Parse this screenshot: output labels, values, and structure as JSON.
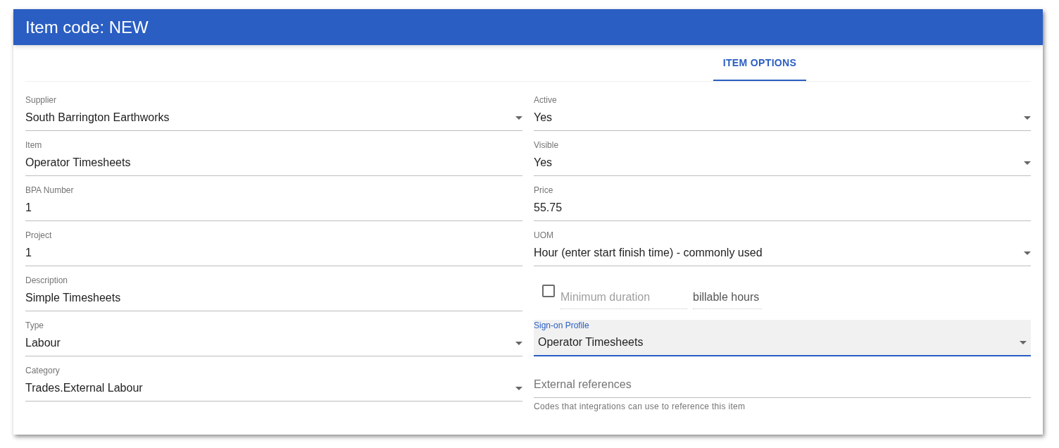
{
  "header": {
    "title": "Item code: NEW"
  },
  "tabs": [
    {
      "label": "ITEM OPTIONS",
      "selected": true
    }
  ],
  "left_fields": [
    {
      "kind": "select",
      "label": "Supplier",
      "value": "South Barrington Earthworks",
      "focused": false
    },
    {
      "kind": "text",
      "label": "Item",
      "value": "Operator Timesheets",
      "focused": false
    },
    {
      "kind": "text",
      "label": "BPA Number",
      "value": "1",
      "focused": false
    },
    {
      "kind": "text",
      "label": "Project",
      "value": "1",
      "focused": false
    },
    {
      "kind": "text",
      "label": "Description",
      "value": "Simple Timesheets",
      "focused": false
    },
    {
      "kind": "select",
      "label": "Type",
      "value": "Labour",
      "focused": false
    },
    {
      "kind": "select",
      "label": "Category",
      "value": "Trades.External Labour",
      "focused": false
    }
  ],
  "right_fields": [
    {
      "kind": "select",
      "label": "Active",
      "value": "Yes",
      "focused": false
    },
    {
      "kind": "select",
      "label": "Visible",
      "value": "Yes",
      "focused": false
    },
    {
      "kind": "text",
      "label": "Price",
      "value": "55.75",
      "focused": false
    },
    {
      "kind": "select",
      "label": "UOM",
      "value": "Hour (enter start finish time) - commonly used",
      "focused": false
    },
    {
      "kind": "duration",
      "checked": false,
      "placeholder": "Minimum duration",
      "suffix": "billable hours"
    },
    {
      "kind": "select",
      "label": "Sign-on Profile",
      "value": "Operator Timesheets",
      "focused": true
    },
    {
      "kind": "empty",
      "placeholder": "External references",
      "helper": "Codes that integrations can use to reference this item"
    }
  ]
}
